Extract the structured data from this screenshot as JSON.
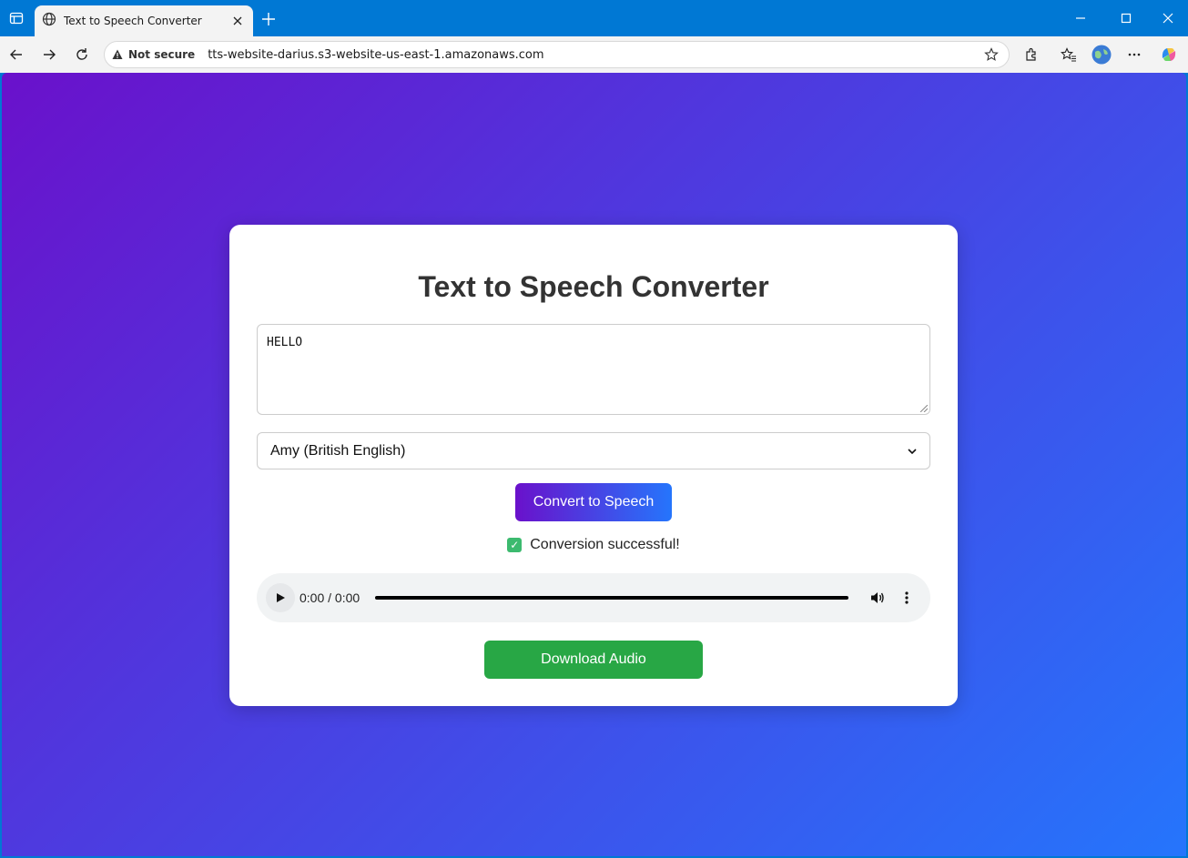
{
  "browser": {
    "tab_title": "Text to Speech Converter",
    "security_label": "Not secure",
    "url": "tts-website-darius.s3-website-us-east-1.amazonaws.com"
  },
  "page": {
    "title": "Text to Speech Converter",
    "text_input": {
      "value": "HELLO"
    },
    "voice_select": {
      "selected": "Amy (British English)"
    },
    "convert_label": "Convert to Speech",
    "status": {
      "icon": "check-mark-icon",
      "text": "Conversion successful!"
    },
    "audio": {
      "time": "0:00 / 0:00"
    },
    "download_label": "Download Audio"
  },
  "colors": {
    "gradient_start": "#6a11cb",
    "gradient_end": "#2575fc",
    "download_green": "#28a745",
    "browser_accent": "#0078d4"
  }
}
